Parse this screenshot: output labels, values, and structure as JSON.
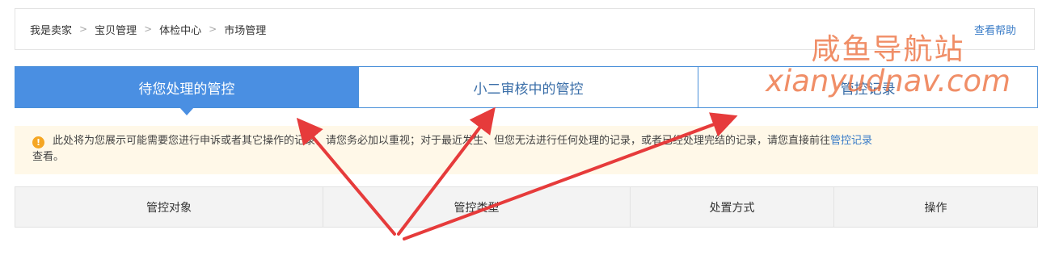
{
  "breadcrumb": {
    "items": [
      "我是卖家",
      "宝贝管理",
      "体检中心",
      "市场管理"
    ],
    "separator": ">",
    "help_label": "查看帮助"
  },
  "tabs": [
    {
      "label": "待您处理的管控",
      "active": true
    },
    {
      "label": "小二审核中的管控",
      "active": false
    },
    {
      "label": "管控记录",
      "active": false
    }
  ],
  "notice": {
    "icon": "warning-icon",
    "text": "此处将为您展示可能需要您进行申诉或者其它操作的记录，请您务必加以重视；对于最近发生、但您无法进行任何处理的记录，或者已经处理完结的记录，请您直接前往",
    "link_label": "管控记录",
    "text_after": "查看。"
  },
  "table": {
    "columns": [
      "管控对象",
      "管控类型",
      "处置方式",
      "操作"
    ]
  },
  "watermark": {
    "line1": "咸鱼导航站",
    "line2": "xianyudnav.com"
  },
  "colors": {
    "accent": "#4a8fe2",
    "link": "#3a7cc7",
    "notice_bg": "#fff8e8",
    "arrow": "#e63b3b",
    "watermark": "#ec6e3c"
  }
}
